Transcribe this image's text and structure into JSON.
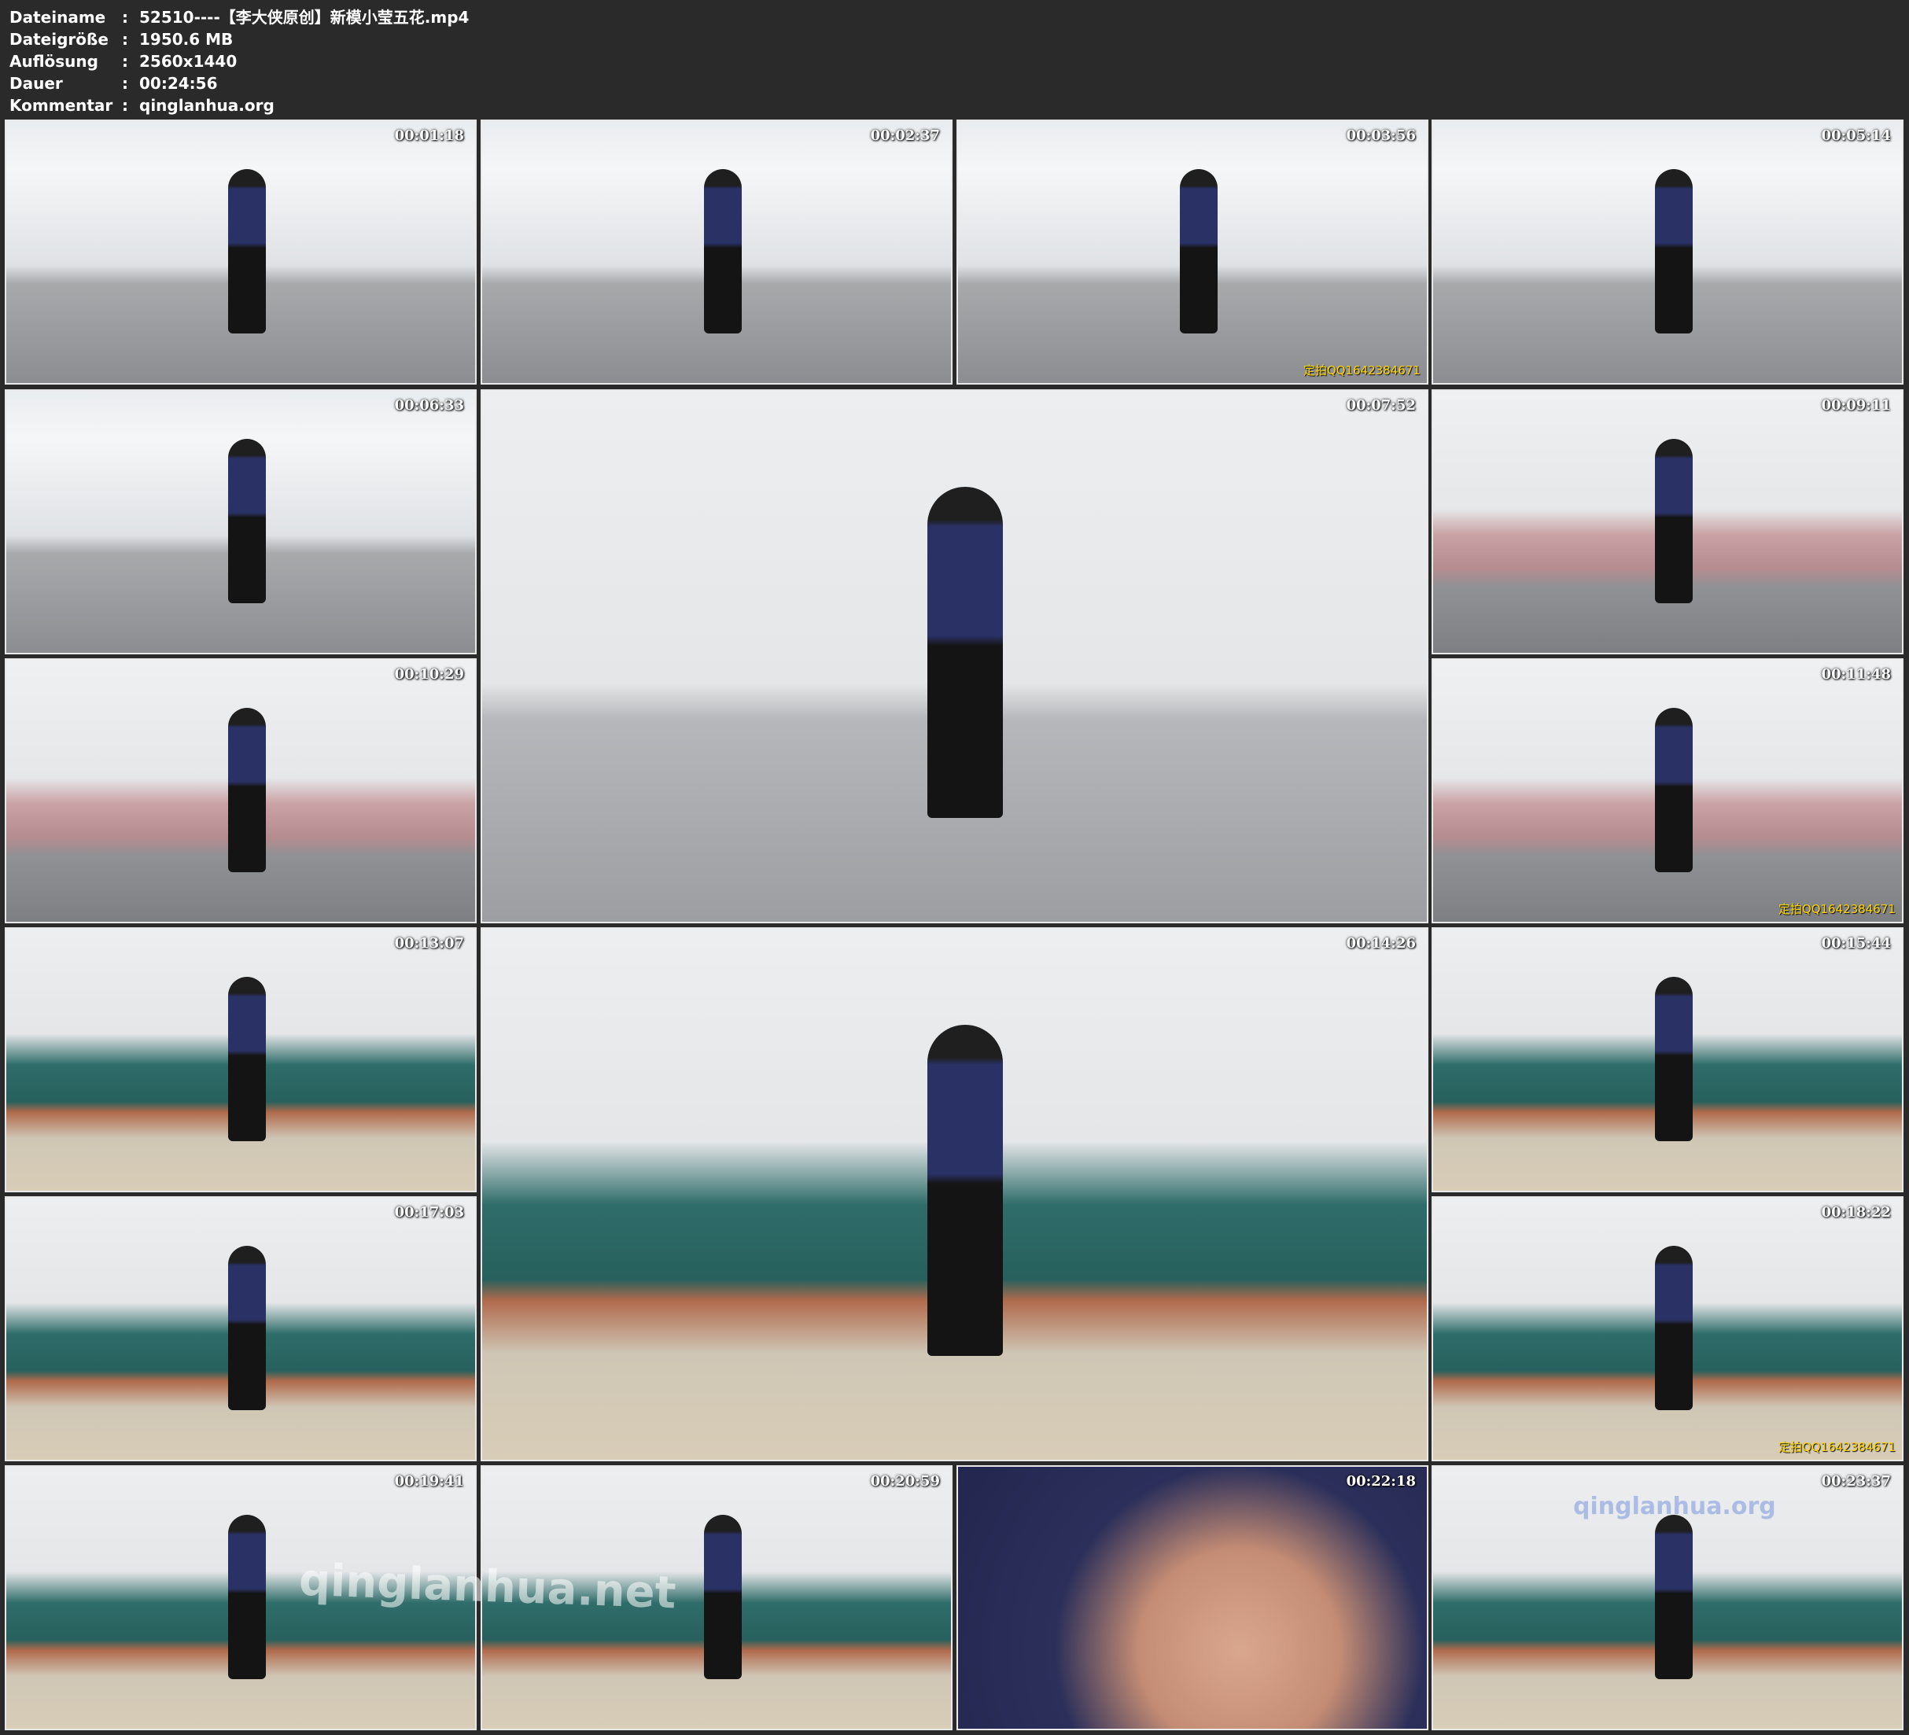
{
  "info": {
    "rows": [
      {
        "label": "Dateiname",
        "sep": ":",
        "value": "52510----【李大侠原创】新模小莹五花.mp4"
      },
      {
        "label": "Dateigröße",
        "sep": ":",
        "value": "1950.6 MB"
      },
      {
        "label": "Auflösung",
        "sep": ":",
        "value": "2560x1440"
      },
      {
        "label": "Dauer",
        "sep": ":",
        "value": "00:24:56"
      },
      {
        "label": "Kommentar",
        "sep": ":",
        "value": "qinglanhua.org"
      }
    ]
  },
  "thumbnails": [
    {
      "time": "00:01:18",
      "scene": "curtains-room"
    },
    {
      "time": "00:02:37",
      "scene": "curtains-room"
    },
    {
      "time": "00:03:56",
      "scene": "curtains-room",
      "watermark": "定拍QQ1642384671"
    },
    {
      "time": "00:05:14",
      "scene": "curtains-room"
    },
    {
      "time": "00:06:33",
      "scene": "curtains-room"
    },
    {
      "time": "00:07:52",
      "scene": "armchair-room"
    },
    {
      "time": "00:09:11",
      "scene": "pink-bed-room"
    },
    {
      "time": "00:10:29",
      "scene": "pink-bed-room"
    },
    {
      "time": "00:11:48",
      "scene": "pink-bed-room",
      "watermark": "定拍QQ1642384671"
    },
    {
      "time": "00:13:07",
      "scene": "green-sofa-room"
    },
    {
      "time": "00:14:26",
      "scene": "green-sofa-room"
    },
    {
      "time": "00:15:44",
      "scene": "green-sofa-room"
    },
    {
      "time": "00:17:03",
      "scene": "green-sofa-room"
    },
    {
      "time": "00:18:22",
      "scene": "green-sofa-room",
      "watermark": "定拍QQ1642384671"
    },
    {
      "time": "00:19:41",
      "scene": "green-sofa-room"
    },
    {
      "time": "00:20:59",
      "scene": "green-sofa-room"
    },
    {
      "time": "00:22:18",
      "scene": "closeup"
    },
    {
      "time": "00:23:37",
      "scene": "green-sofa-room"
    }
  ],
  "overlay_watermarks": [
    "qinglanhua.net",
    "qinglanhua.org"
  ]
}
